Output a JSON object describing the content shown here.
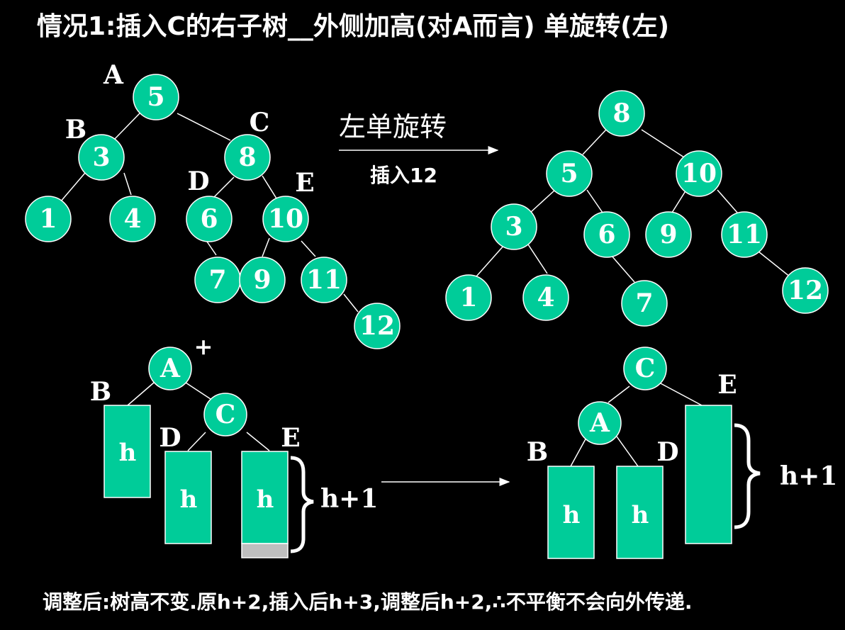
{
  "title": "情况1:插入C的右子树__外侧加高(对A而言)    单旋转(左)",
  "footer": "调整后:树高不变.原h+2,插入后h+3,调整后h+2,∴不平衡不会向外传递.",
  "colors": {
    "node_fill": "#00cc99",
    "background": "#000000",
    "text": "#ffffff",
    "shade": "#bfbfbf"
  },
  "top_arrow": {
    "label": "左单旋转",
    "sublabel": "插入12"
  },
  "top_left_tree": {
    "nodes": [
      "5",
      "3",
      "8",
      "1",
      "4",
      "6",
      "10",
      "7",
      "9",
      "11",
      "12"
    ],
    "labels": [
      "A",
      "B",
      "C",
      "D",
      "E"
    ]
  },
  "top_right_tree": {
    "nodes": [
      "8",
      "5",
      "10",
      "3",
      "6",
      "9",
      "11",
      "1",
      "4",
      "7",
      "12"
    ]
  },
  "bottom_left": {
    "nodes": [
      "A",
      "C"
    ],
    "plus": "+",
    "labels": [
      "B",
      "D",
      "E"
    ],
    "subtrees": [
      "h",
      "h",
      "h"
    ],
    "brace_label": "h+1"
  },
  "bottom_right": {
    "nodes": [
      "C",
      "A"
    ],
    "labels": [
      "E",
      "B",
      "D"
    ],
    "subtrees": [
      "h",
      "h"
    ],
    "brace_label": "h+1"
  }
}
